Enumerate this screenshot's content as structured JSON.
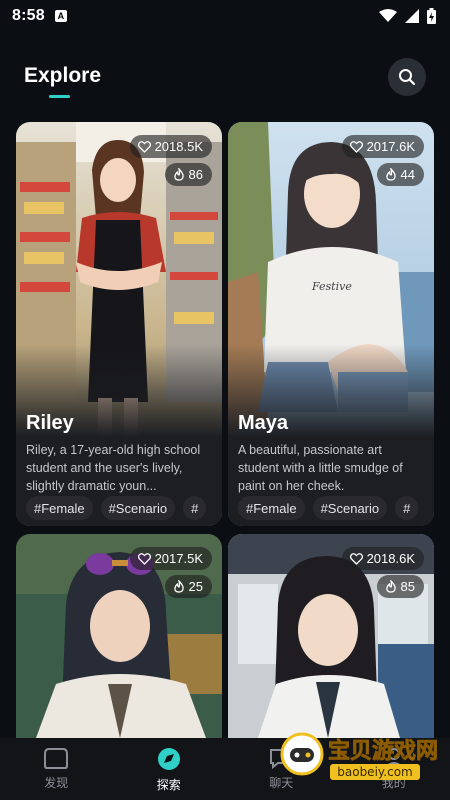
{
  "status": {
    "time": "8:58",
    "a_badge": "A"
  },
  "header": {
    "title": "Explore"
  },
  "cards": [
    {
      "likes": "2018.5K",
      "fires": "86",
      "name": "Riley",
      "desc": "Riley, a 17-year-old high school student and the user's lively, slightly dramatic youn...",
      "tags": [
        "#Female",
        "#Scenario",
        "#"
      ]
    },
    {
      "likes": "2017.6K",
      "fires": "44",
      "name": "Maya",
      "desc": "A beautiful, passionate art student with a little smudge of paint on her cheek.",
      "tags": [
        "#Female",
        "#Scenario",
        "#"
      ]
    },
    {
      "likes": "2017.5K",
      "fires": "25"
    },
    {
      "likes": "2018.6K",
      "fires": "85"
    }
  ],
  "nav": {
    "discover": "发现",
    "explore": "探索",
    "chat": "聊天",
    "mine": "我的"
  },
  "watermark": {
    "line1": "宝贝游戏网",
    "line2": "baobeiy.com"
  },
  "colors": {
    "accent": "#2fd0c8",
    "background": "#0b0f14"
  }
}
